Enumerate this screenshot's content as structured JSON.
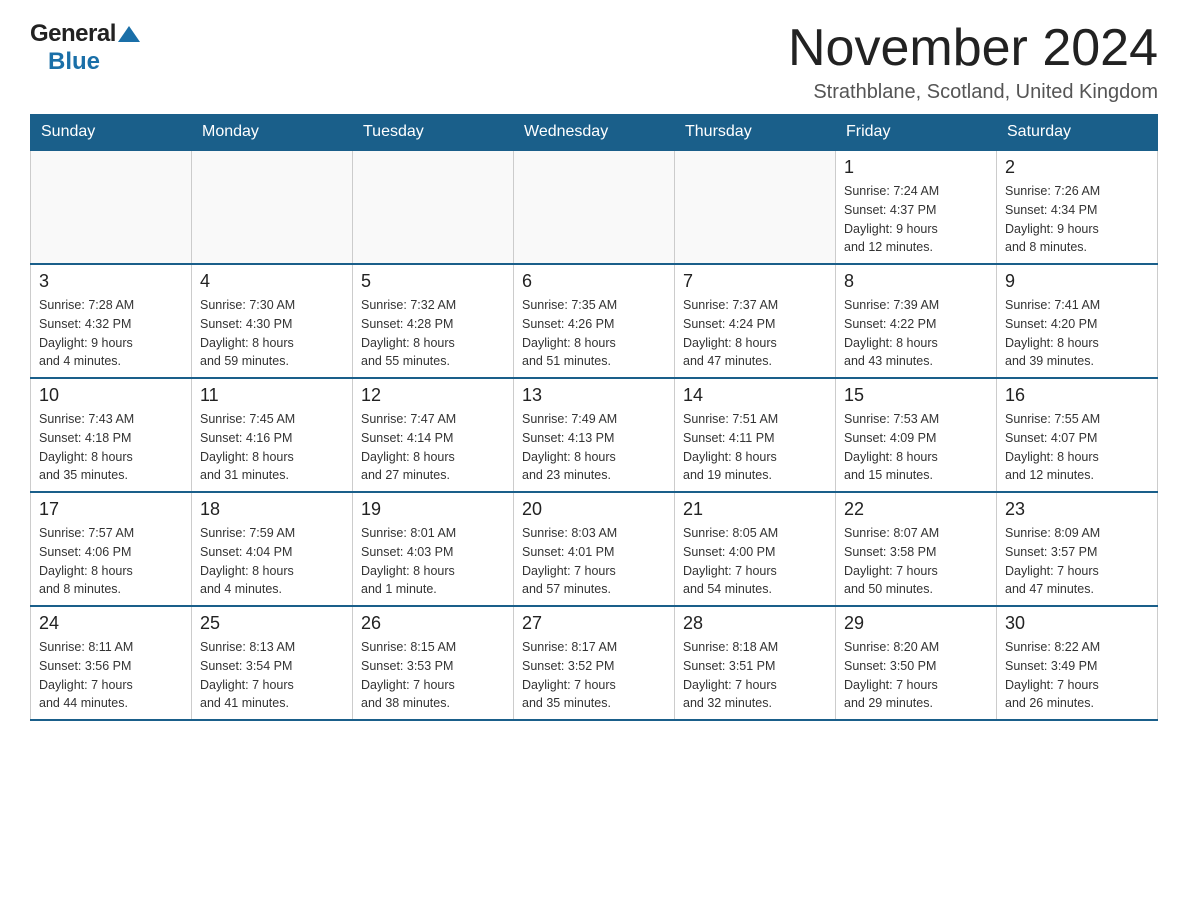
{
  "header": {
    "logo_general": "General",
    "logo_blue": "Blue",
    "month_title": "November 2024",
    "location": "Strathblane, Scotland, United Kingdom"
  },
  "weekdays": [
    "Sunday",
    "Monday",
    "Tuesday",
    "Wednesday",
    "Thursday",
    "Friday",
    "Saturday"
  ],
  "weeks": [
    [
      {
        "day": "",
        "info": ""
      },
      {
        "day": "",
        "info": ""
      },
      {
        "day": "",
        "info": ""
      },
      {
        "day": "",
        "info": ""
      },
      {
        "day": "",
        "info": ""
      },
      {
        "day": "1",
        "info": "Sunrise: 7:24 AM\nSunset: 4:37 PM\nDaylight: 9 hours\nand 12 minutes."
      },
      {
        "day": "2",
        "info": "Sunrise: 7:26 AM\nSunset: 4:34 PM\nDaylight: 9 hours\nand 8 minutes."
      }
    ],
    [
      {
        "day": "3",
        "info": "Sunrise: 7:28 AM\nSunset: 4:32 PM\nDaylight: 9 hours\nand 4 minutes."
      },
      {
        "day": "4",
        "info": "Sunrise: 7:30 AM\nSunset: 4:30 PM\nDaylight: 8 hours\nand 59 minutes."
      },
      {
        "day": "5",
        "info": "Sunrise: 7:32 AM\nSunset: 4:28 PM\nDaylight: 8 hours\nand 55 minutes."
      },
      {
        "day": "6",
        "info": "Sunrise: 7:35 AM\nSunset: 4:26 PM\nDaylight: 8 hours\nand 51 minutes."
      },
      {
        "day": "7",
        "info": "Sunrise: 7:37 AM\nSunset: 4:24 PM\nDaylight: 8 hours\nand 47 minutes."
      },
      {
        "day": "8",
        "info": "Sunrise: 7:39 AM\nSunset: 4:22 PM\nDaylight: 8 hours\nand 43 minutes."
      },
      {
        "day": "9",
        "info": "Sunrise: 7:41 AM\nSunset: 4:20 PM\nDaylight: 8 hours\nand 39 minutes."
      }
    ],
    [
      {
        "day": "10",
        "info": "Sunrise: 7:43 AM\nSunset: 4:18 PM\nDaylight: 8 hours\nand 35 minutes."
      },
      {
        "day": "11",
        "info": "Sunrise: 7:45 AM\nSunset: 4:16 PM\nDaylight: 8 hours\nand 31 minutes."
      },
      {
        "day": "12",
        "info": "Sunrise: 7:47 AM\nSunset: 4:14 PM\nDaylight: 8 hours\nand 27 minutes."
      },
      {
        "day": "13",
        "info": "Sunrise: 7:49 AM\nSunset: 4:13 PM\nDaylight: 8 hours\nand 23 minutes."
      },
      {
        "day": "14",
        "info": "Sunrise: 7:51 AM\nSunset: 4:11 PM\nDaylight: 8 hours\nand 19 minutes."
      },
      {
        "day": "15",
        "info": "Sunrise: 7:53 AM\nSunset: 4:09 PM\nDaylight: 8 hours\nand 15 minutes."
      },
      {
        "day": "16",
        "info": "Sunrise: 7:55 AM\nSunset: 4:07 PM\nDaylight: 8 hours\nand 12 minutes."
      }
    ],
    [
      {
        "day": "17",
        "info": "Sunrise: 7:57 AM\nSunset: 4:06 PM\nDaylight: 8 hours\nand 8 minutes."
      },
      {
        "day": "18",
        "info": "Sunrise: 7:59 AM\nSunset: 4:04 PM\nDaylight: 8 hours\nand 4 minutes."
      },
      {
        "day": "19",
        "info": "Sunrise: 8:01 AM\nSunset: 4:03 PM\nDaylight: 8 hours\nand 1 minute."
      },
      {
        "day": "20",
        "info": "Sunrise: 8:03 AM\nSunset: 4:01 PM\nDaylight: 7 hours\nand 57 minutes."
      },
      {
        "day": "21",
        "info": "Sunrise: 8:05 AM\nSunset: 4:00 PM\nDaylight: 7 hours\nand 54 minutes."
      },
      {
        "day": "22",
        "info": "Sunrise: 8:07 AM\nSunset: 3:58 PM\nDaylight: 7 hours\nand 50 minutes."
      },
      {
        "day": "23",
        "info": "Sunrise: 8:09 AM\nSunset: 3:57 PM\nDaylight: 7 hours\nand 47 minutes."
      }
    ],
    [
      {
        "day": "24",
        "info": "Sunrise: 8:11 AM\nSunset: 3:56 PM\nDaylight: 7 hours\nand 44 minutes."
      },
      {
        "day": "25",
        "info": "Sunrise: 8:13 AM\nSunset: 3:54 PM\nDaylight: 7 hours\nand 41 minutes."
      },
      {
        "day": "26",
        "info": "Sunrise: 8:15 AM\nSunset: 3:53 PM\nDaylight: 7 hours\nand 38 minutes."
      },
      {
        "day": "27",
        "info": "Sunrise: 8:17 AM\nSunset: 3:52 PM\nDaylight: 7 hours\nand 35 minutes."
      },
      {
        "day": "28",
        "info": "Sunrise: 8:18 AM\nSunset: 3:51 PM\nDaylight: 7 hours\nand 32 minutes."
      },
      {
        "day": "29",
        "info": "Sunrise: 8:20 AM\nSunset: 3:50 PM\nDaylight: 7 hours\nand 29 minutes."
      },
      {
        "day": "30",
        "info": "Sunrise: 8:22 AM\nSunset: 3:49 PM\nDaylight: 7 hours\nand 26 minutes."
      }
    ]
  ]
}
